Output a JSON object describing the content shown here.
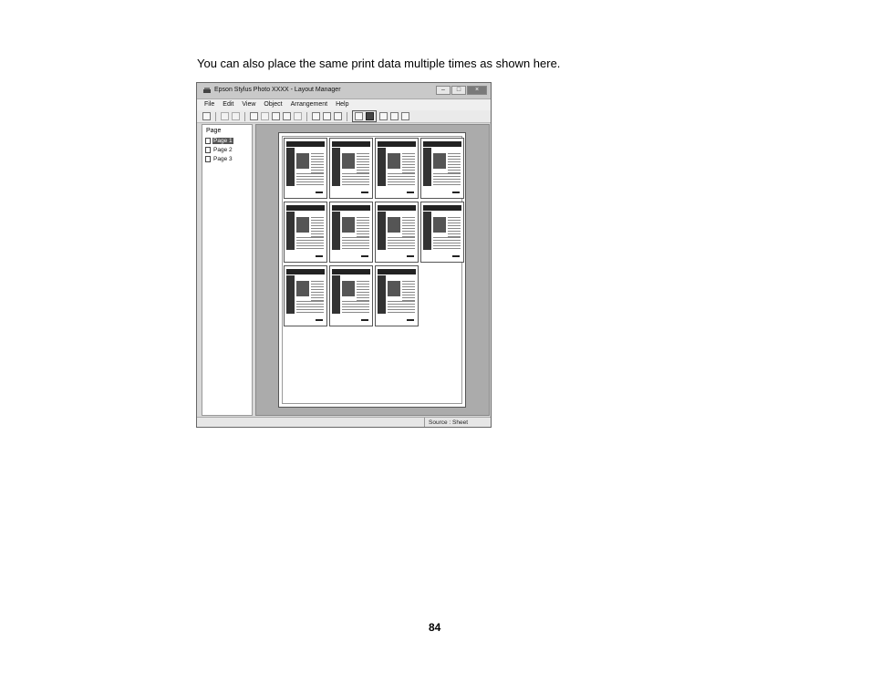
{
  "document": {
    "intro_text": "You can also place the same print data multiple times as shown here.",
    "page_number": "84"
  },
  "window": {
    "title": "Epson Stylus Photo XXXX - Layout Manager",
    "menu": [
      "File",
      "Edit",
      "View",
      "Object",
      "Arrangement",
      "Help"
    ],
    "page_panel": {
      "title": "Page",
      "items": [
        {
          "label": "Page 1",
          "selected": true
        },
        {
          "label": "Page 2",
          "selected": false
        },
        {
          "label": "Page 3",
          "selected": false
        }
      ]
    },
    "layout": {
      "copies_per_row": [
        4,
        4,
        3
      ],
      "total_copies": 11
    },
    "status": "Source : Sheet"
  }
}
